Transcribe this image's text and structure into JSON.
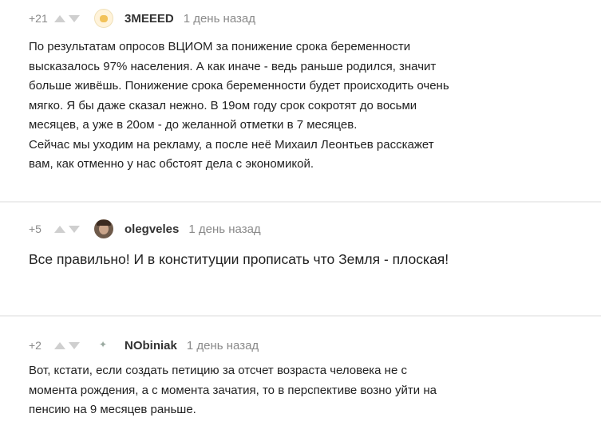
{
  "comments": [
    {
      "rating": "+21",
      "username": "3MEEED",
      "time": "1 день назад",
      "avatar_icon": "chicken-avatar-icon",
      "text": "По результатам опросов ВЦИОМ за понижение срока беременности\nвысказалось 97% населения. А как иначе - ведь раньше родился, значит\nбольше живёшь. Понижение срока беременности будет происходить очень\nмягко. Я бы даже сказал нежно. В 19ом году срок сокротят до восьми\nмесяцев, а уже в 20ом - до желанной отметки в 7 месяцев.\nСейчас мы уходим на рекламу, а после неё Михаил Леонтьев расскажет\nвам, как отменно у нас обстоят дела с экономикой."
    },
    {
      "rating": "+5",
      "username": "olegveles",
      "time": "1 день назад",
      "avatar_icon": "user-photo-avatar-icon",
      "text": "Все правильно! И в конституции прописать что Земля - плоская!"
    },
    {
      "rating": "+2",
      "username": "NObiniak",
      "time": "1 день назад",
      "avatar_icon": "bird-avatar-icon",
      "text": "Вот, кстати, если создать петицию за отсчет возраста человека не с\nмомента рождения, а с момента зачатия, то в перспективе возно уйти на\nпенсию на 9 месяцев раньше."
    }
  ]
}
